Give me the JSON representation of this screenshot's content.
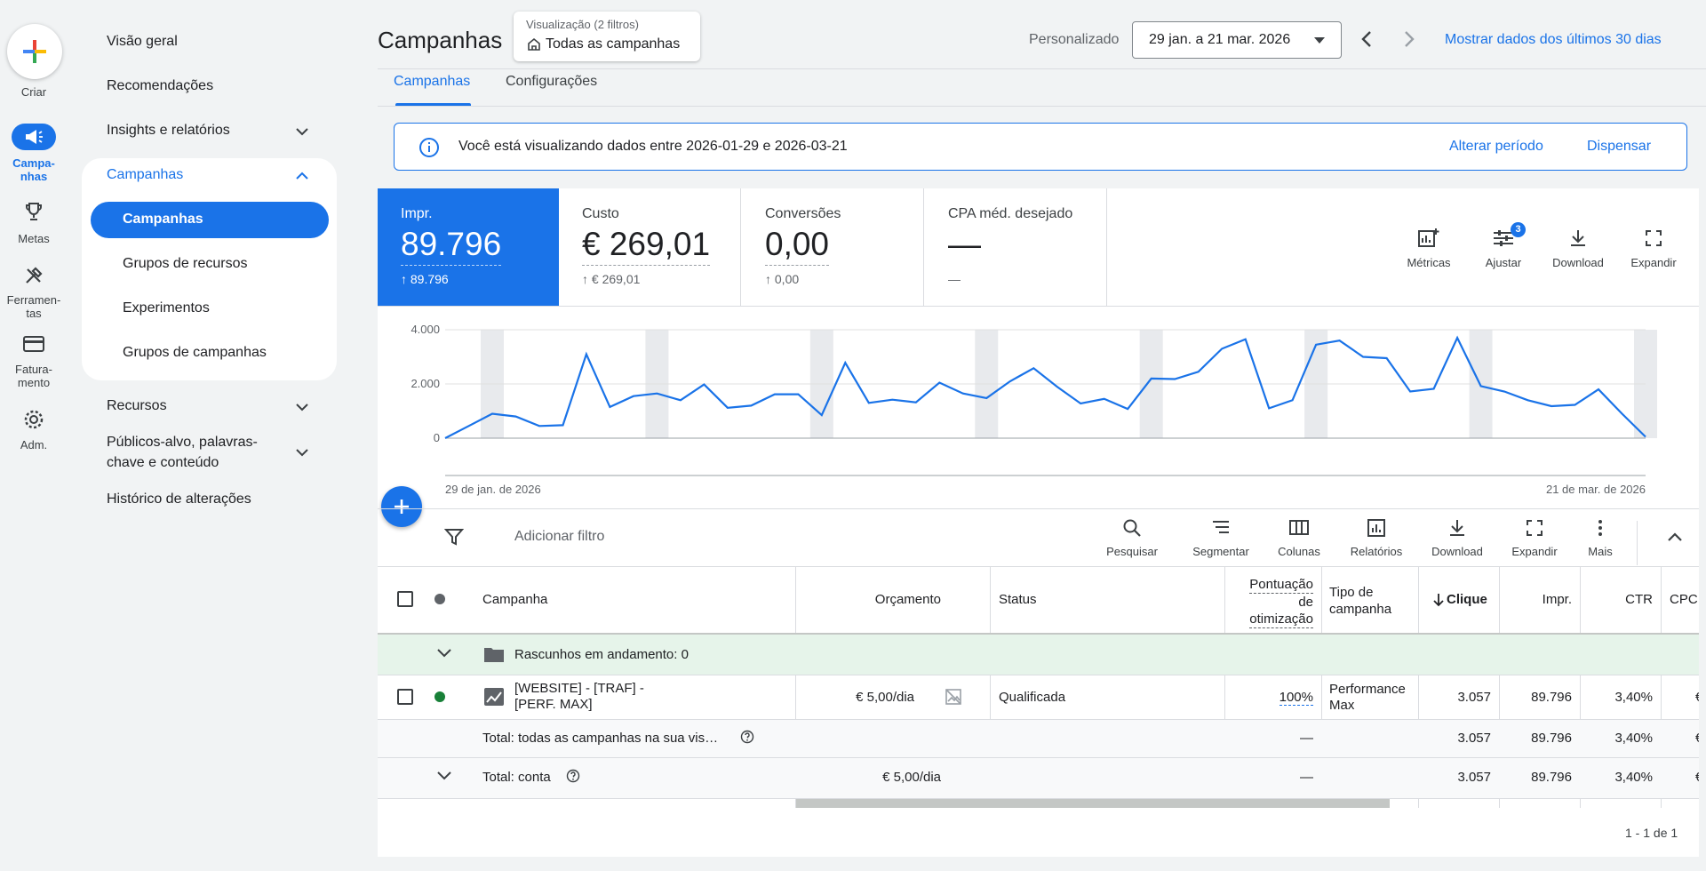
{
  "rail": {
    "create": "Criar",
    "items": [
      {
        "label": "Campa-\nnhas",
        "icon": "megaphone-icon"
      },
      {
        "label": "Metas",
        "icon": "trophy-icon"
      },
      {
        "label": "Ferramen-\ntas",
        "icon": "tools-icon"
      },
      {
        "label": "Fatura-\nmento",
        "icon": "credit-card-icon"
      },
      {
        "label": "Adm.",
        "icon": "gear-icon"
      }
    ]
  },
  "nav": {
    "overview": "Visão geral",
    "recommendations": "Recomendações",
    "insights": "Insights e relatórios",
    "campaigns_group": "Campanhas",
    "sub": [
      "Campanhas",
      "Grupos de recursos",
      "Experimentos",
      "Grupos de campanhas"
    ],
    "resources": "Recursos",
    "audiences_line1": "Públicos-alvo, palavras-",
    "audiences_line2": "chave e conteúdo",
    "history": "Histórico de alterações"
  },
  "header": {
    "title": "Campanhas",
    "filter_caption": "Visualização (2 filtros)",
    "filter_value": "Todas as campanhas",
    "range_label": "Personalizado",
    "range_value": "29 jan. a 21 mar. 2026",
    "last30": "Mostrar dados dos últimos 30 dias"
  },
  "tabs": [
    "Campanhas",
    "Configurações"
  ],
  "banner": {
    "text": "Você está visualizando dados entre 2026-01-29 e 2026-03-21",
    "change": "Alterar período",
    "dismiss": "Dispensar"
  },
  "metrics": [
    {
      "label": "Impr.",
      "value": "89.796",
      "delta": "↑ 89.796"
    },
    {
      "label": "Custo",
      "value": "€ 269,01",
      "delta": "↑ € 269,01"
    },
    {
      "label": "Conversões",
      "value": "0,00",
      "delta": "↑ 0,00"
    },
    {
      "label": "CPA méd. desejado",
      "value": "—",
      "delta": "—"
    }
  ],
  "metric_tools": {
    "metrics": "Métricas",
    "adjust": "Ajustar",
    "adjust_badge": "3",
    "download": "Download",
    "expand": "Expandir"
  },
  "chart_data": {
    "type": "line",
    "x_start_label": "29 de jan. de 2026",
    "x_end_label": "21 de mar. de 2026",
    "yticks": [
      "4.000",
      "2.000",
      "0"
    ],
    "ylim": [
      0,
      4000
    ],
    "color": "#1a73e8",
    "values": [
      0,
      450,
      900,
      800,
      450,
      480,
      3100,
      1150,
      1550,
      1650,
      1400,
      1980,
      1120,
      1200,
      1620,
      1620,
      850,
      2780,
      1300,
      1420,
      1320,
      2050,
      1650,
      1480,
      2100,
      2580,
      1900,
      1280,
      1450,
      1080,
      2200,
      2180,
      2450,
      3300,
      3650,
      1100,
      1400,
      3450,
      3600,
      3000,
      2950,
      1720,
      1820,
      3700,
      1920,
      1720,
      1400,
      1180,
      1230,
      1800,
      900,
      50
    ]
  },
  "toolbar": {
    "add_filter": "Adicionar filtro",
    "search": "Pesquisar",
    "segment": "Segmentar",
    "columns": "Colunas",
    "reports": "Relatórios",
    "download": "Download",
    "expand": "Expandir",
    "more": "Mais"
  },
  "table": {
    "headers": {
      "campaign": "Campanha",
      "budget": "Orçamento",
      "status": "Status",
      "opt1": "Pontuação",
      "opt2": "de",
      "opt3": "otimização",
      "type1": "Tipo de",
      "type2": "campanha",
      "clicks": "Clique",
      "impr": "Impr.",
      "ctr": "CTR",
      "cpc": "CPC"
    },
    "drafts": "Rascunhos em andamento: 0",
    "row": {
      "name1": "[WEBSITE] -  [TRAF] -",
      "name2": "[PERF. MAX]",
      "budget": "€ 5,00/dia",
      "status": "Qualificada",
      "opt": "100%",
      "type1": "Performance",
      "type2": "Max",
      "clicks": "3.057",
      "impr": "89.796",
      "ctr": "3,40%",
      "cpc": "€"
    },
    "total_all": {
      "label": "Total: todas as campanhas na sua vis…",
      "opt": "—",
      "clicks": "3.057",
      "impr": "89.796",
      "ctr": "3,40%",
      "cpc": "€"
    },
    "total_account": {
      "label": "Total: conta",
      "budget": "€ 5,00/dia",
      "opt": "—",
      "clicks": "3.057",
      "impr": "89.796",
      "ctr": "3,40%",
      "cpc": "€"
    },
    "pagination": "1 - 1 de 1"
  }
}
